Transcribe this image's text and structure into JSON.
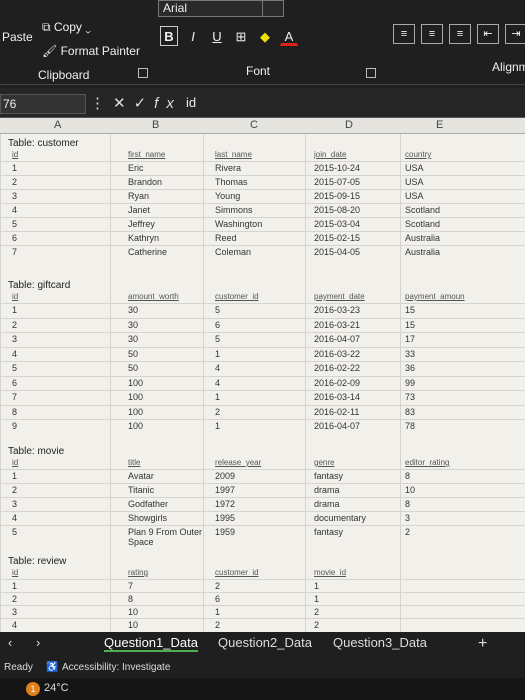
{
  "ribbon": {
    "paste_label": "Paste",
    "copy_label": "Copy",
    "format_painter_label": "Format Painter",
    "clipboard_label": "Clipboard",
    "font_name": "Arial",
    "bold": "B",
    "italic": "I",
    "underline": "U",
    "font_group_label": "Font",
    "alignment_group_label": "Alignm"
  },
  "formula_bar": {
    "name_box": "76",
    "content": "id"
  },
  "columns": [
    "A",
    "B",
    "C",
    "D",
    "E"
  ],
  "tables": {
    "customer": {
      "title": "Table: customer",
      "headers": [
        "id",
        "first_name",
        "last_name",
        "join_date",
        "country"
      ],
      "rows": [
        [
          "1",
          "Eric",
          "Rivera",
          "2015-10-24",
          "USA"
        ],
        [
          "2",
          "Brandon",
          "Thomas",
          "2015-07-05",
          "USA"
        ],
        [
          "3",
          "Ryan",
          "Young",
          "2015-09-15",
          "USA"
        ],
        [
          "4",
          "Janet",
          "Simmons",
          "2015-08-20",
          "Scotland"
        ],
        [
          "5",
          "Jeffrey",
          "Washington",
          "2015-03-04",
          "Scotland"
        ],
        [
          "6",
          "Kathryn",
          "Reed",
          "2015-02-15",
          "Australia"
        ],
        [
          "7",
          "Catherine",
          "Coleman",
          "2015-04-05",
          "Australia"
        ]
      ]
    },
    "giftcard": {
      "title": "Table: giftcard",
      "headers": [
        "id",
        "amount_worth",
        "customer_id",
        "payment_date",
        "payment_amoun"
      ],
      "rows": [
        [
          "1",
          "30",
          "5",
          "2016-03-23",
          "15"
        ],
        [
          "2",
          "30",
          "6",
          "2016-03-21",
          "15"
        ],
        [
          "3",
          "30",
          "5",
          "2016-04-07",
          "17"
        ],
        [
          "4",
          "50",
          "1",
          "2016-03-22",
          "33"
        ],
        [
          "5",
          "50",
          "4",
          "2016-02-22",
          "36"
        ],
        [
          "6",
          "100",
          "4",
          "2016-02-09",
          "99"
        ],
        [
          "7",
          "100",
          "1",
          "2016-03-14",
          "73"
        ],
        [
          "8",
          "100",
          "2",
          "2016-02-11",
          "83"
        ],
        [
          "9",
          "100",
          "1",
          "2016-04-07",
          "78"
        ]
      ]
    },
    "movie": {
      "title": "Table: movie",
      "headers": [
        "id",
        "title",
        "release_year",
        "genre",
        "editor_rating"
      ],
      "rows": [
        [
          "1",
          "Avatar",
          "2009",
          "fantasy",
          "8"
        ],
        [
          "2",
          "Titanic",
          "1997",
          "drama",
          "10"
        ],
        [
          "3",
          "Godfather",
          "1972",
          "drama",
          "8"
        ],
        [
          "4",
          "Showgirls",
          "1995",
          "documentary",
          "3"
        ],
        [
          "5",
          "Plan 9 From Outer Space",
          "1959",
          "fantasy",
          "2"
        ]
      ]
    },
    "review": {
      "title": "Table: review",
      "headers": [
        "id",
        "rating",
        "customer_id",
        "movie_id"
      ],
      "rows": [
        [
          "1",
          "7",
          "2",
          "1"
        ],
        [
          "2",
          "8",
          "6",
          "1"
        ],
        [
          "3",
          "10",
          "1",
          "2"
        ],
        [
          "4",
          "10",
          "2",
          "2"
        ]
      ]
    }
  },
  "row_numbers": [
    "2",
    "3",
    "4",
    "5",
    "6",
    "7",
    "8",
    "9",
    "0",
    "1",
    "2",
    "3",
    "4",
    "5",
    "6",
    "7",
    "8",
    "9",
    "0",
    "1",
    "32",
    "33",
    "34",
    "35",
    "36"
  ],
  "sheet_tabs": [
    "Question1_Data",
    "Question2_Data",
    "Question3_Data"
  ],
  "add_sheet": "+",
  "status": {
    "ready": "Ready",
    "accessibility": "Accessibility: Investigate"
  },
  "taskbar": {
    "temperature": "24°C"
  }
}
